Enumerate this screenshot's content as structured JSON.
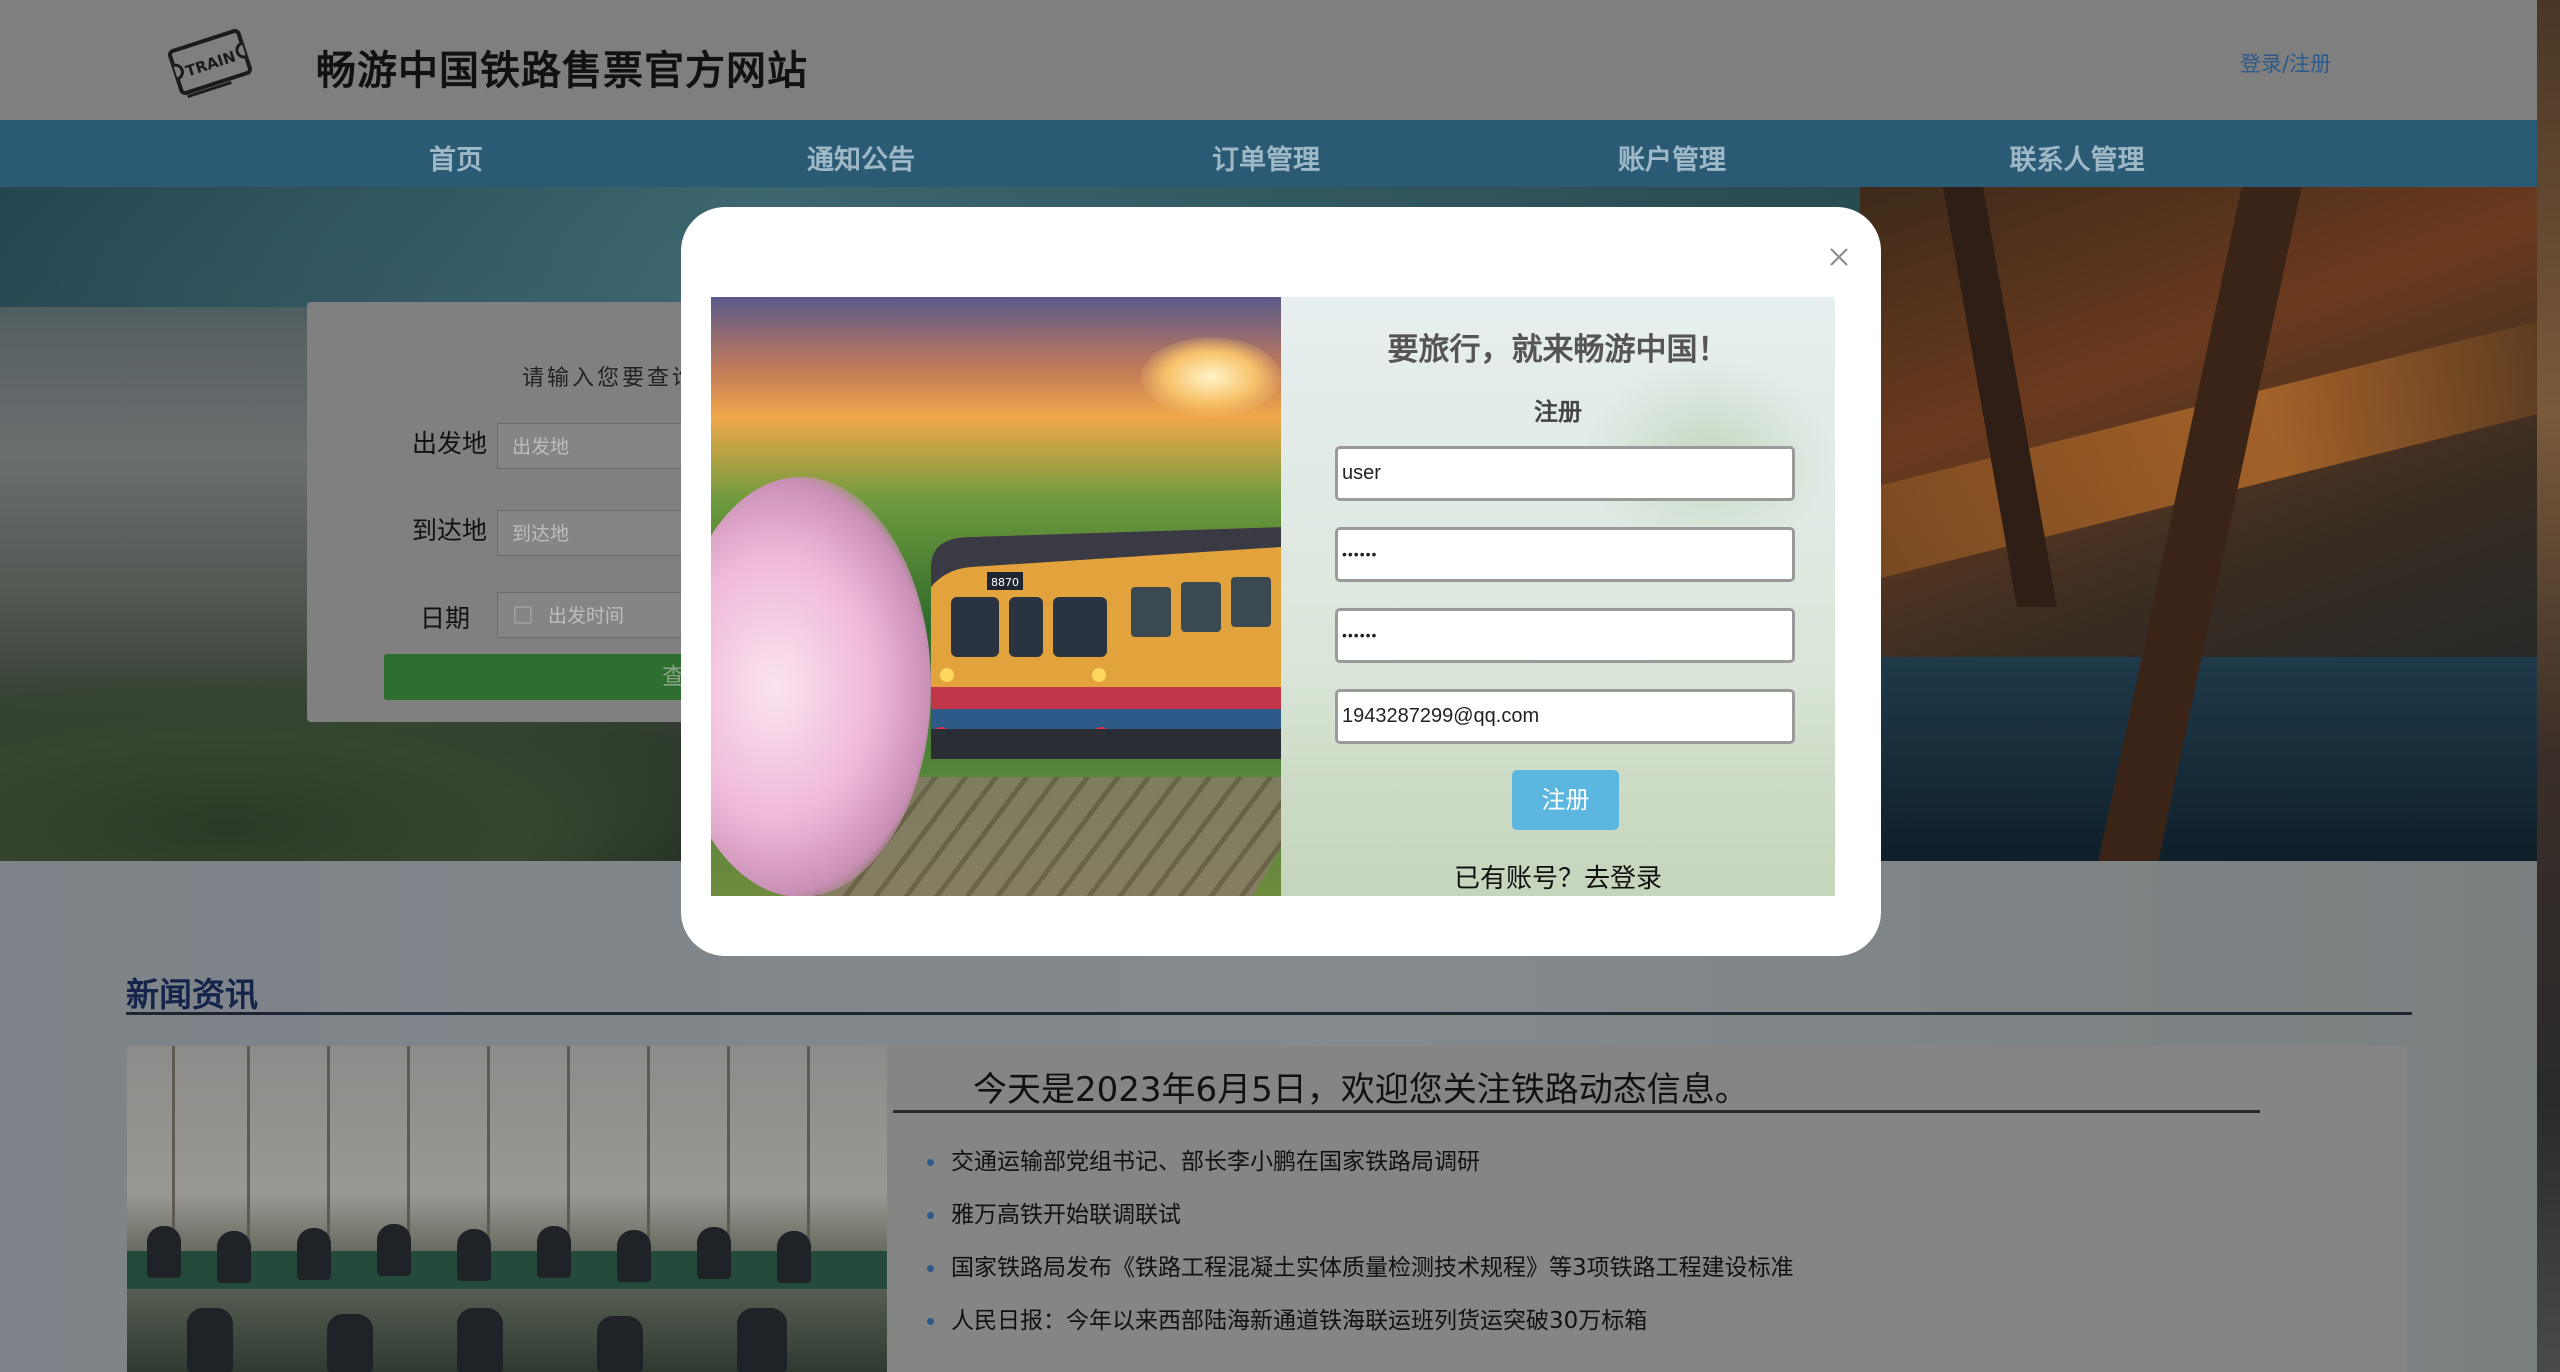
{
  "header": {
    "site_title": "畅游中国铁路售票官方网站",
    "logo_text": "TRAIN",
    "login_link": "登录/注册"
  },
  "nav": {
    "items": [
      {
        "label": "首页"
      },
      {
        "label": "通知公告"
      },
      {
        "label": "订单管理"
      },
      {
        "label": "账户管理"
      },
      {
        "label": "联系人管理"
      }
    ]
  },
  "search": {
    "hint": "请输入您要查询",
    "from_label": "出发地",
    "from_placeholder": "出发地",
    "to_label": "到达地",
    "to_placeholder": "到达地",
    "date_label": "日期",
    "date_placeholder": "出发时间",
    "submit_label": "查"
  },
  "modal": {
    "slogan": "要旅行，就来畅游中国！",
    "heading": "注册",
    "username_value": "user",
    "password_value": "••••••",
    "confirm_password_value": "••••••",
    "email_value": "1943287299@qq.com",
    "submit_label": "注册",
    "login_prompt": "已有账号？去登录",
    "art_train_sign": "8870"
  },
  "news": {
    "section_title": "新闻资讯",
    "greeting": "今天是2023年6月5日，欢迎您关注铁路动态信息。",
    "items": [
      "交通运输部党组书记、部长李小鹏在国家铁路局调研",
      "雅万高铁开始联调联试",
      "国家铁路局发布《铁路工程混凝土实体质量检测技术规程》等3项铁路工程建设标准",
      "人民日报：今年以来西部陆海新通道铁海联运班列货运突破30万标箱"
    ]
  },
  "colors": {
    "nav_bg": "#2b5a75",
    "register_button": "#5bb6e0",
    "search_button": "#3a9a3a",
    "news_title": "#1a2f5c"
  }
}
